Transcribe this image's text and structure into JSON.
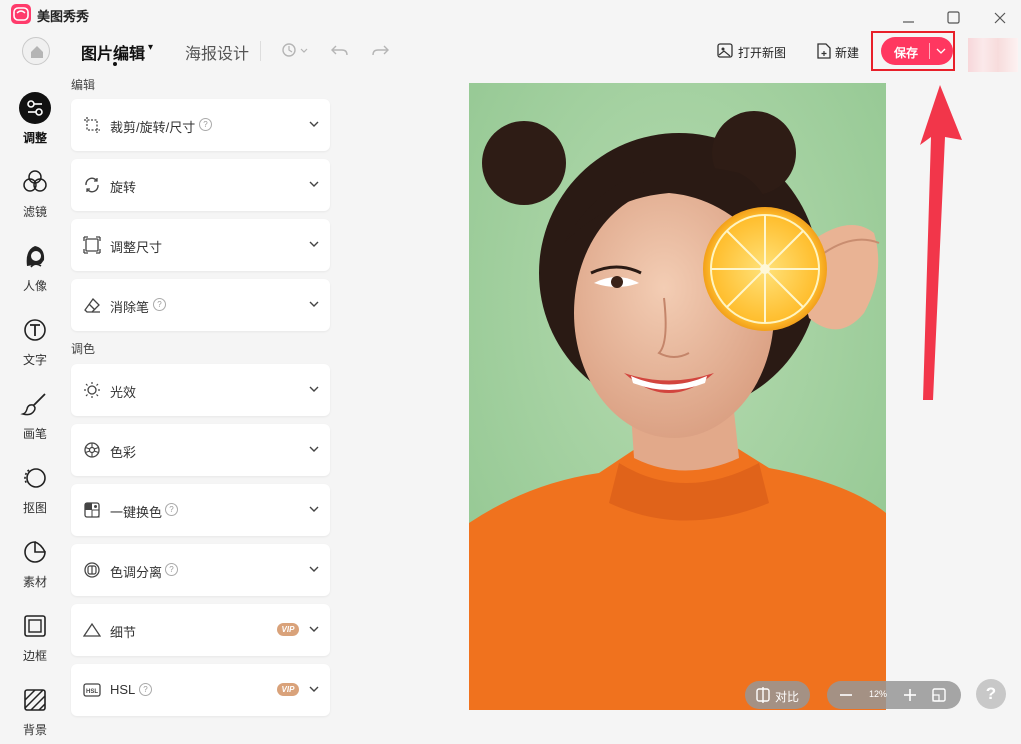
{
  "app": {
    "name": "美图秀秀"
  },
  "header": {
    "tabs": [
      {
        "label": "图片编辑"
      },
      {
        "label": "海报设计"
      }
    ],
    "open_label": "打开新图",
    "new_label": "新建",
    "save_label": "保存"
  },
  "nav": [
    {
      "label": "调整",
      "icon": "adjust-icon",
      "active": true
    },
    {
      "label": "滤镜",
      "icon": "filter-icon"
    },
    {
      "label": "人像",
      "icon": "portrait-icon"
    },
    {
      "label": "文字",
      "icon": "text-icon"
    },
    {
      "label": "画笔",
      "icon": "brush-icon"
    },
    {
      "label": "抠图",
      "icon": "cutout-icon"
    },
    {
      "label": "素材",
      "icon": "sticker-icon"
    },
    {
      "label": "边框",
      "icon": "frame-icon"
    },
    {
      "label": "背景",
      "icon": "background-icon"
    }
  ],
  "panel": {
    "section_edit": "编辑",
    "section_color": "调色",
    "items": [
      {
        "label": "裁剪/旋转/尺寸",
        "icon": "crop-icon",
        "help": true
      },
      {
        "label": "旋转",
        "icon": "rotate-icon"
      },
      {
        "label": "调整尺寸",
        "icon": "resize-icon"
      },
      {
        "label": "消除笔",
        "icon": "eraser-icon",
        "help": true
      },
      {
        "label": "光效",
        "icon": "light-icon"
      },
      {
        "label": "色彩",
        "icon": "color-icon"
      },
      {
        "label": "一键换色",
        "icon": "recolor-icon",
        "help": true
      },
      {
        "label": "色调分离",
        "icon": "split-tone-icon",
        "help": true
      },
      {
        "label": "细节",
        "icon": "detail-icon",
        "vip": "VIP"
      },
      {
        "label": "HSL",
        "icon": "hsl-icon",
        "help": true,
        "vip": "VIP"
      }
    ]
  },
  "canvas": {
    "compare_label": "对比",
    "zoom": "12%"
  },
  "colors": {
    "accent": "#ff3760",
    "highlight": "#e8202a",
    "arrow": "#f2364a"
  }
}
